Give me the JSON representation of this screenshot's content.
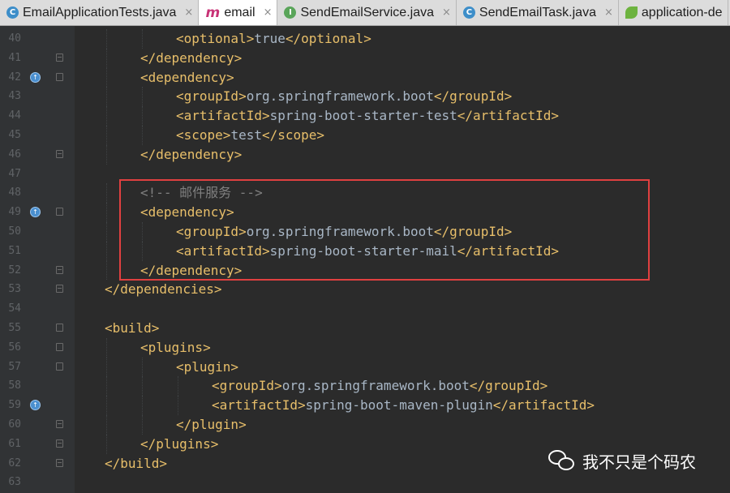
{
  "tabs": [
    {
      "label": "EmailApplicationTests.java",
      "icon": "class-icon",
      "glyph": "C",
      "active": false
    },
    {
      "label": "email",
      "icon": "maven-icon",
      "glyph": "m",
      "active": true
    },
    {
      "label": "SendEmailService.java",
      "icon": "interface-icon",
      "glyph": "I",
      "active": false
    },
    {
      "label": "SendEmailTask.java",
      "icon": "class-icon",
      "glyph": "C",
      "active": false
    },
    {
      "label": "application-de",
      "icon": "spring-leaf-icon",
      "glyph": "",
      "active": false
    }
  ],
  "tab_close_glyph": "×",
  "lines": [
    {
      "num": "40",
      "indent": 2,
      "segs": [
        [
          "tag",
          "<optional>"
        ],
        [
          "txt",
          "true"
        ],
        [
          "tag",
          "</optional>"
        ]
      ]
    },
    {
      "num": "41",
      "indent": 1,
      "fold": "close",
      "segs": [
        [
          "tag",
          "</dependency>"
        ]
      ]
    },
    {
      "num": "42",
      "indent": 1,
      "fold": "open",
      "gicon": true,
      "segs": [
        [
          "tag",
          "<dependency>"
        ]
      ]
    },
    {
      "num": "43",
      "indent": 2,
      "segs": [
        [
          "tag",
          "<groupId>"
        ],
        [
          "txt",
          "org.springframework.boot"
        ],
        [
          "tag",
          "</groupId>"
        ]
      ]
    },
    {
      "num": "44",
      "indent": 2,
      "segs": [
        [
          "tag",
          "<artifactId>"
        ],
        [
          "txt",
          "spring-boot-starter-test"
        ],
        [
          "tag",
          "</artifactId>"
        ]
      ]
    },
    {
      "num": "45",
      "indent": 2,
      "segs": [
        [
          "tag",
          "<scope>"
        ],
        [
          "txt",
          "test"
        ],
        [
          "tag",
          "</scope>"
        ]
      ]
    },
    {
      "num": "46",
      "indent": 1,
      "fold": "close",
      "segs": [
        [
          "tag",
          "</dependency>"
        ]
      ]
    },
    {
      "num": "47",
      "indent": 0,
      "segs": []
    },
    {
      "num": "48",
      "indent": 1,
      "segs": [
        [
          "cmt",
          "<!-- 邮件服务 -->"
        ]
      ]
    },
    {
      "num": "49",
      "indent": 1,
      "fold": "open",
      "gicon": true,
      "segs": [
        [
          "tag",
          "<dependency>"
        ]
      ]
    },
    {
      "num": "50",
      "indent": 2,
      "segs": [
        [
          "tag",
          "<groupId>"
        ],
        [
          "txt",
          "org.springframework.boot"
        ],
        [
          "tag",
          "</groupId>"
        ]
      ]
    },
    {
      "num": "51",
      "indent": 2,
      "segs": [
        [
          "tag",
          "<artifactId>"
        ],
        [
          "txt",
          "spring-boot-starter-mail"
        ],
        [
          "tag",
          "</artifactId>"
        ]
      ]
    },
    {
      "num": "52",
      "indent": 1,
      "fold": "close",
      "segs": [
        [
          "tag",
          "</dependency>"
        ]
      ]
    },
    {
      "num": "53",
      "indent": 0,
      "fold": "close",
      "segs": [
        [
          "tag",
          "</dependencies>"
        ]
      ]
    },
    {
      "num": "54",
      "indent": 0,
      "segs": []
    },
    {
      "num": "55",
      "indent": 0,
      "fold": "open",
      "segs": [
        [
          "tag",
          "<build>"
        ]
      ]
    },
    {
      "num": "56",
      "indent": 1,
      "fold": "open",
      "segs": [
        [
          "tag",
          "<plugins>"
        ]
      ]
    },
    {
      "num": "57",
      "indent": 2,
      "fold": "open",
      "segs": [
        [
          "tag",
          "<plugin>"
        ]
      ]
    },
    {
      "num": "58",
      "indent": 3,
      "segs": [
        [
          "tag",
          "<groupId>"
        ],
        [
          "txt",
          "org.springframework.boot"
        ],
        [
          "tag",
          "</groupId>"
        ]
      ]
    },
    {
      "num": "59",
      "indent": 3,
      "gicon": true,
      "segs": [
        [
          "tag",
          "<artifactId>"
        ],
        [
          "txt",
          "spring-boot-maven-plugin"
        ],
        [
          "tag",
          "</artifactId>"
        ]
      ]
    },
    {
      "num": "60",
      "indent": 2,
      "fold": "close",
      "segs": [
        [
          "tag",
          "</plugin>"
        ]
      ]
    },
    {
      "num": "61",
      "indent": 1,
      "fold": "close",
      "segs": [
        [
          "tag",
          "</plugins>"
        ]
      ]
    },
    {
      "num": "62",
      "indent": 0,
      "fold": "close",
      "segs": [
        [
          "tag",
          "</build>"
        ]
      ]
    },
    {
      "num": "63",
      "indent": 0,
      "segs": []
    }
  ],
  "gutter_icon_glyph": "↑",
  "watermark": {
    "text": "我不只是个码农",
    "icon": "wechat-icon"
  },
  "colors": {
    "background": "#2b2b2b",
    "tag": "#e8bf6a",
    "text": "#a9b7c6",
    "comment": "#808080",
    "highlight": "#e04040"
  }
}
